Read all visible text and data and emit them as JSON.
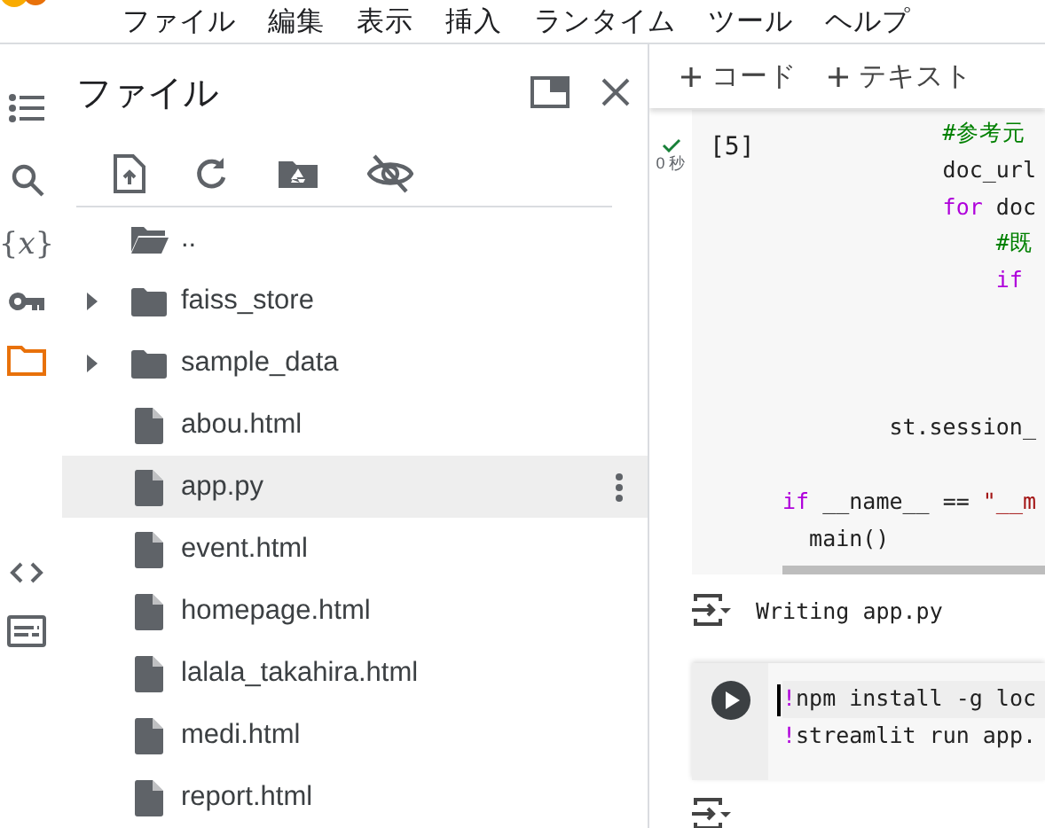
{
  "menu": [
    "ファイル",
    "編集",
    "表示",
    "挿入",
    "ランタイム",
    "ツール",
    "ヘルプ"
  ],
  "rail": [
    {
      "kind": "toc",
      "selected": false
    },
    {
      "kind": "search",
      "selected": false
    },
    {
      "kind": "variables",
      "glyph": "{𝑥}",
      "selected": false
    },
    {
      "kind": "key",
      "selected": false
    },
    {
      "kind": "files",
      "selected": true
    },
    {
      "kind": "code",
      "selected": false
    },
    {
      "kind": "terminal",
      "selected": false
    }
  ],
  "file_panel": {
    "title": "ファイル",
    "items": [
      {
        "name": "..",
        "kind": "parent",
        "selected": false
      },
      {
        "name": "faiss_store",
        "kind": "folder",
        "selected": false
      },
      {
        "name": "sample_data",
        "kind": "folder",
        "selected": false
      },
      {
        "name": "abou.html",
        "kind": "file",
        "selected": false
      },
      {
        "name": "app.py",
        "kind": "file",
        "selected": true
      },
      {
        "name": "event.html",
        "kind": "file",
        "selected": false
      },
      {
        "name": "homepage.html",
        "kind": "file",
        "selected": false
      },
      {
        "name": "lalala_takahira.html",
        "kind": "file",
        "selected": false
      },
      {
        "name": "medi.html",
        "kind": "file",
        "selected": false
      },
      {
        "name": "report.html",
        "kind": "file",
        "selected": false
      }
    ]
  },
  "notebook": {
    "toolbar": [
      "コード",
      "テキスト"
    ],
    "cells": [
      {
        "executed": true,
        "duration": "0 秒",
        "count": "[5]",
        "code": [
          {
            "text": "            #参考元",
            "kind": "comment"
          },
          {
            "text": "\n            doc_url"
          },
          {
            "text": "\n            for",
            "kind": "keyword"
          },
          {
            "text": " doc"
          },
          {
            "text": "\n                #既",
            "kind": "comment"
          },
          {
            "text": "\n                if",
            "kind": "keyword"
          },
          {
            "text": "\n\n\n\n        st.session_\n\n"
          },
          {
            "text": "if",
            "kind": "keyword"
          },
          {
            "text": " __name__ == "
          },
          {
            "text": "\"__m",
            "kind": "string"
          },
          {
            "text": "\n  main()"
          }
        ],
        "output": "Writing app.py"
      },
      {
        "executed": false,
        "code": [
          {
            "text": "!",
            "kind": "keyword"
          },
          {
            "text": "npm install -g loc"
          },
          {
            "text": "\n!",
            "kind": "keyword"
          },
          {
            "text": "streamlit run app."
          }
        ]
      }
    ]
  }
}
